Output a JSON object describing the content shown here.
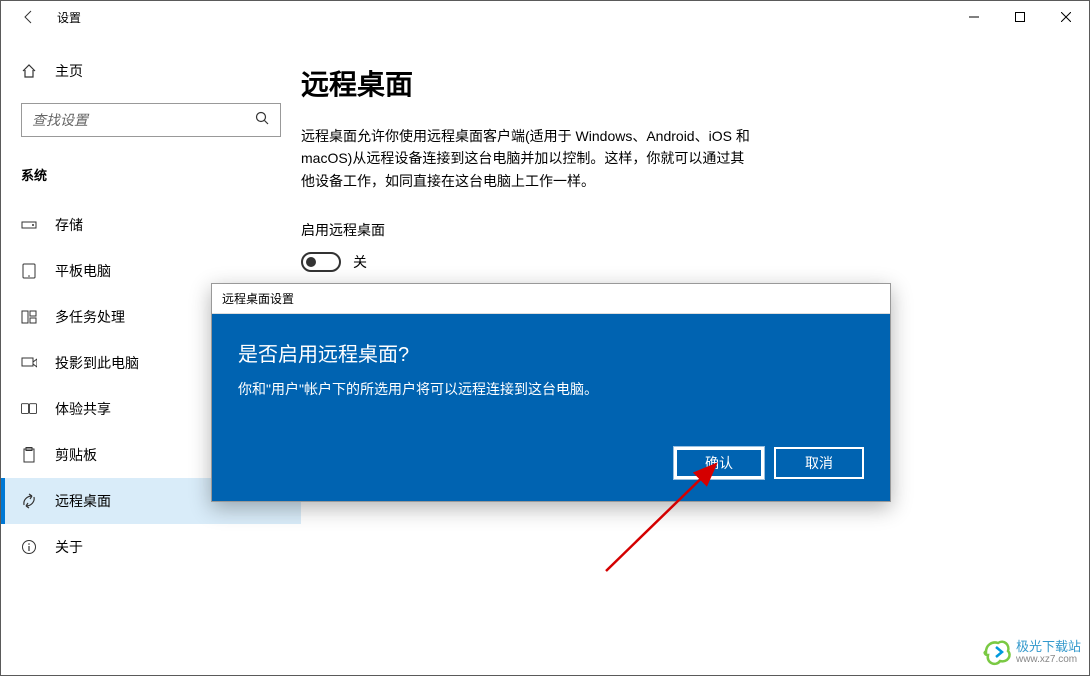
{
  "window": {
    "title": "设置"
  },
  "sidebar": {
    "home": "主页",
    "search_placeholder": "查找设置",
    "category": "系统",
    "items": [
      {
        "label": "存储"
      },
      {
        "label": "平板电脑"
      },
      {
        "label": "多任务处理"
      },
      {
        "label": "投影到此电脑"
      },
      {
        "label": "体验共享"
      },
      {
        "label": "剪贴板"
      },
      {
        "label": "远程桌面"
      },
      {
        "label": "关于"
      }
    ]
  },
  "content": {
    "title": "远程桌面",
    "description": "远程桌面允许你使用远程桌面客户端(适用于 Windows、Android、iOS 和 macOS)从远程设备连接到这台电脑并加以控制。这样，你就可以通过其他设备工作，如同直接在这台电脑上工作一样。",
    "toggle_label": "启用远程桌面",
    "toggle_state": "关"
  },
  "dialog": {
    "header": "远程桌面设置",
    "title": "是否启用远程桌面?",
    "text": "你和\"用户\"帐户下的所选用户将可以远程连接到这台电脑。",
    "confirm": "确认",
    "cancel": "取消"
  },
  "watermark": {
    "text": "极光下载站",
    "url": "www.xz7.com"
  }
}
